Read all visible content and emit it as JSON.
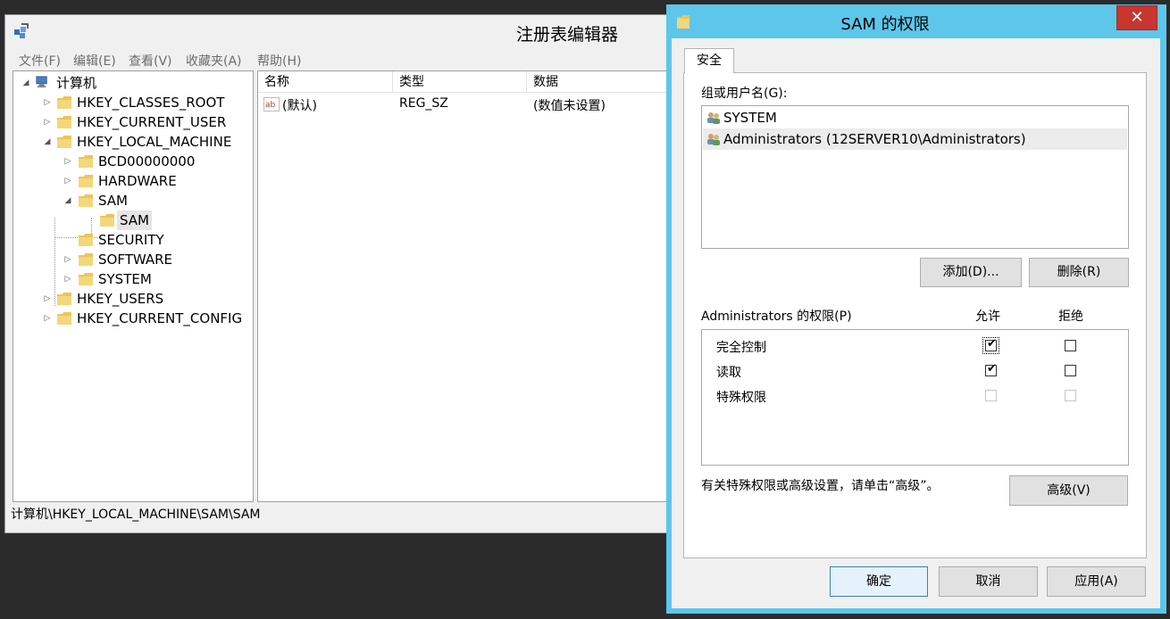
{
  "regedit": {
    "title": "注册表编辑器",
    "menu": [
      "文件(F)",
      "编辑(E)",
      "查看(V)",
      "收藏夹(A)",
      "帮助(H)"
    ],
    "tree": {
      "root": "计算机",
      "nodes": [
        "HKEY_CLASSES_ROOT",
        "HKEY_CURRENT_USER",
        "HKEY_LOCAL_MACHINE",
        "BCD00000000",
        "HARDWARE",
        "SAM",
        "SAM",
        "SECURITY",
        "SOFTWARE",
        "SYSTEM",
        "HKEY_USERS",
        "HKEY_CURRENT_CONFIG"
      ],
      "selected": "SAM"
    },
    "list": {
      "columns": [
        "名称",
        "类型",
        "数据"
      ],
      "rows": [
        {
          "name": "(默认)",
          "type": "REG_SZ",
          "data": "(数值未设置)"
        }
      ]
    },
    "status": "计算机\\HKEY_LOCAL_MACHINE\\SAM\\SAM"
  },
  "dialog": {
    "title": "SAM 的权限",
    "close": "✕",
    "tab": "安全",
    "groups_label": "组或用户名(G):",
    "users": [
      "SYSTEM",
      "Administrators (12SERVER10\\Administrators)"
    ],
    "add_button": "添加(D)...",
    "remove_button": "删除(R)",
    "perm_title": "Administrators 的权限(P)",
    "allow_header": "允许",
    "deny_header": "拒绝",
    "permissions": [
      {
        "name": "完全控制",
        "allow": true,
        "deny": false
      },
      {
        "name": "读取",
        "allow": true,
        "deny": false
      },
      {
        "name": "特殊权限",
        "allow": false,
        "deny": false
      }
    ],
    "advanced_text": "有关特殊权限或高级设置，请单击“高级”。",
    "advanced_button": "高级(V)",
    "ok_button": "确定",
    "cancel_button": "取消",
    "apply_button": "应用(A)"
  }
}
